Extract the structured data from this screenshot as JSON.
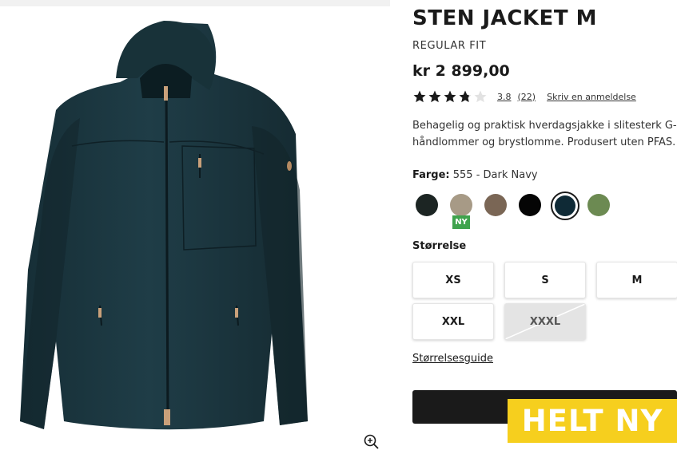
{
  "product": {
    "title": "STEN JACKET M",
    "fit": "REGULAR FIT",
    "price": "kr 2 899,00",
    "rating_value": "3.8",
    "rating_count": "(22)",
    "rating_fraction": 0.76,
    "review_link": "Skriv en anmeldelse",
    "description_line1": "Behagelig og praktisk hverdagsjakke i slitesterk G-",
    "description_line2": "håndlommer og brystlomme. Produsert uten PFAS."
  },
  "color": {
    "label": "Farge:",
    "value": "555 - Dark Navy",
    "swatches": [
      {
        "name": "dark-green",
        "hex": "#1c2523"
      },
      {
        "name": "sand",
        "hex": "#a79a86"
      },
      {
        "name": "brown",
        "hex": "#7a6655"
      },
      {
        "name": "black",
        "hex": "#050505"
      },
      {
        "name": "dark-navy",
        "hex": "#0f2a36"
      },
      {
        "name": "green",
        "hex": "#6c8a52"
      }
    ],
    "new_badge": "NY"
  },
  "size": {
    "label": "Størrelse",
    "options": [
      "XS",
      "S",
      "M",
      "XXL",
      "XXXL"
    ],
    "guide": "Størrelsesguide"
  },
  "promo": {
    "text": "HELT NY"
  },
  "icons": {
    "zoom": "zoom-in-icon",
    "star": "star-icon"
  }
}
